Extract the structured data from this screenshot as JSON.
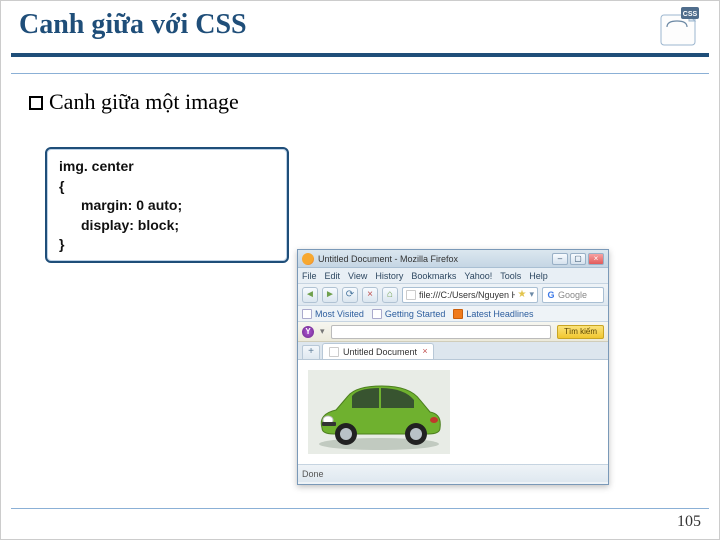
{
  "title": "Canh giữa với CSS",
  "subtitle": "Canh giữa một image",
  "code": {
    "selector": "img. center",
    "open": "{",
    "line1": "margin: 0 auto;",
    "line2": "display: block;",
    "close": "}"
  },
  "browser": {
    "window_title": "Untitled Document - Mozilla Firefox",
    "menu": [
      "File",
      "Edit",
      "View",
      "History",
      "Bookmarks",
      "Yahoo!",
      "Tools",
      "Help"
    ],
    "url": "file:///C:/Users/Nguyen Ha Giang/Doc",
    "search_placeholder": "Google",
    "bookmarks": {
      "most_visited": "Most Visited",
      "getting_started": "Getting Started",
      "latest_headlines": "Latest Headlines"
    },
    "yahoo_button": "Tìm kiếm",
    "tab_label": "Untitled Document",
    "status": "Done"
  },
  "page_number": "105"
}
